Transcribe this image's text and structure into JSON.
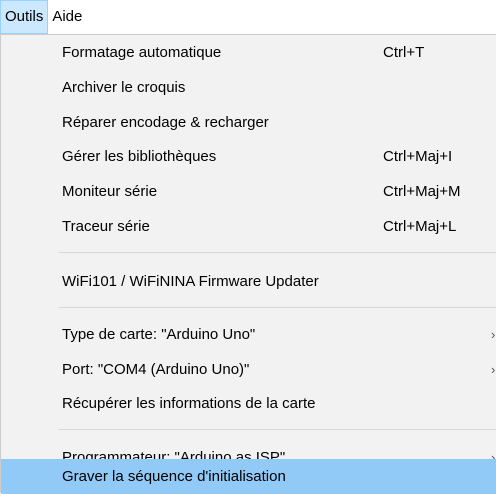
{
  "menubar": {
    "items": [
      {
        "label": "Outils"
      },
      {
        "label": "Aide"
      }
    ]
  },
  "menu": {
    "items": [
      {
        "label": "Formatage automatique",
        "shortcut": "Ctrl+T"
      },
      {
        "label": "Archiver le croquis",
        "shortcut": ""
      },
      {
        "label": "Réparer encodage & recharger",
        "shortcut": ""
      },
      {
        "label": "Gérer les bibliothèques",
        "shortcut": "Ctrl+Maj+I"
      },
      {
        "label": "Moniteur série",
        "shortcut": "Ctrl+Maj+M"
      },
      {
        "label": "Traceur série",
        "shortcut": "Ctrl+Maj+L"
      },
      {
        "label": "WiFi101 / WiFiNINA Firmware Updater",
        "shortcut": ""
      },
      {
        "label": "Type de carte: \"Arduino Uno\"",
        "submenu_arrow": "›"
      },
      {
        "label": "Port: \"COM4 (Arduino Uno)\"",
        "submenu_arrow": "›"
      },
      {
        "label": "Récupérer les informations de la carte",
        "shortcut": ""
      },
      {
        "label": "Programmateur: \"Arduino as ISP\"",
        "submenu_arrow": "›"
      },
      {
        "label": "Graver la séquence d'initialisation",
        "shortcut": ""
      }
    ]
  },
  "colors": {
    "menu_background": "#f2f2f2",
    "highlight": "#91c9f7",
    "menubar_active": "#cce8ff"
  }
}
